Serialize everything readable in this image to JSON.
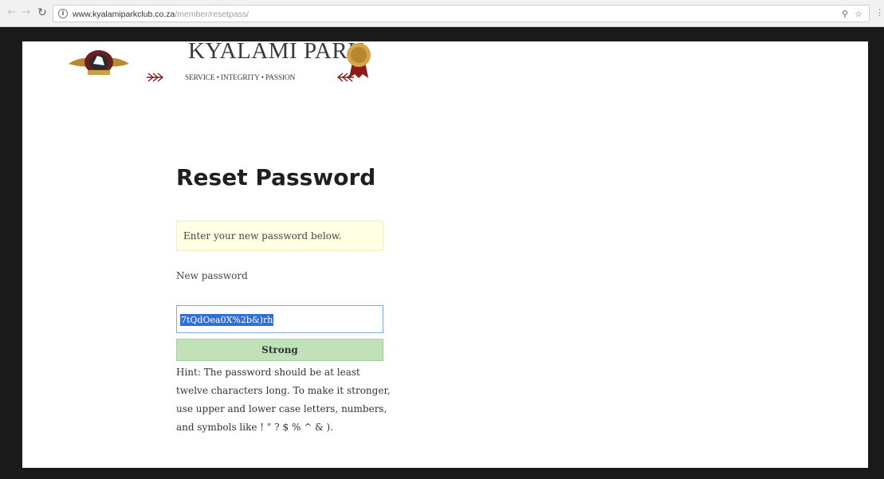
{
  "browser": {
    "url_domain": "www.kyalamiparkclub.co.za",
    "url_path": "/member/resetpass/",
    "icons": [
      "back-icon",
      "forward-icon",
      "reload-icon",
      "info-icon",
      "key-icon",
      "star-icon",
      "menu-icon"
    ]
  },
  "header": {
    "brand_name": "KYALAMI PARK",
    "tagline": "SERVICE • INTEGRITY • PASSION"
  },
  "form": {
    "title": "Reset Password",
    "notice": "Enter your new password below.",
    "new_password_label": "New password",
    "password_value": "7tQdOea0X%2b&)rh",
    "strength_label": "Strong",
    "hint": "Hint: The password should be at least twelve characters long. To make it stronger, use upper and lower case letters, numbers, and symbols like ! \" ? $ % ^ & )."
  },
  "colors": {
    "notice_bg": "#ffffe3",
    "strength_bg": "#c1e1b9",
    "selection_bg": "#2f6fd6",
    "input_border": "#7ea7e8",
    "frame": "#1a1a1a"
  }
}
